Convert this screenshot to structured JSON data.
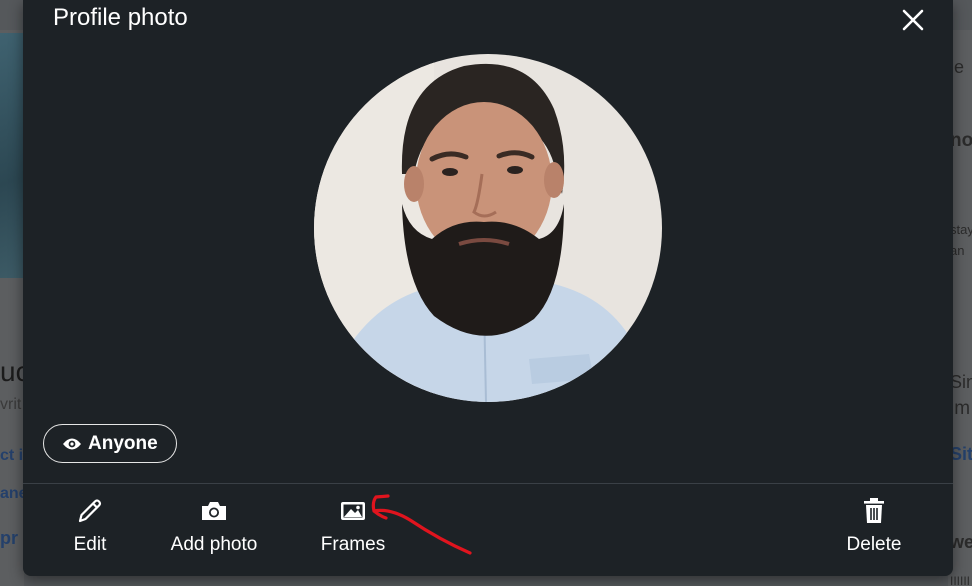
{
  "modal": {
    "title": "Profile photo",
    "visibility_label": "Anyone",
    "actions": {
      "edit": "Edit",
      "add_photo": "Add photo",
      "frames": "Frames",
      "delete": "Delete"
    }
  },
  "background": {
    "left_fragments": [
      "uc",
      "vrit",
      "ct i",
      "ane",
      "pr"
    ],
    "right_fragments": [
      "le",
      "no",
      "stay",
      "an",
      "Sinc",
      "im",
      "Sit",
      "we",
      "IIIIII"
    ]
  },
  "colors": {
    "modal_bg": "#1d2226",
    "annotation_red": "#e0141e"
  },
  "icons": {
    "close": "close-icon",
    "eye": "eye-icon",
    "edit": "pencil-icon",
    "add_photo": "camera-icon",
    "frames": "image-icon",
    "delete": "trash-icon"
  }
}
